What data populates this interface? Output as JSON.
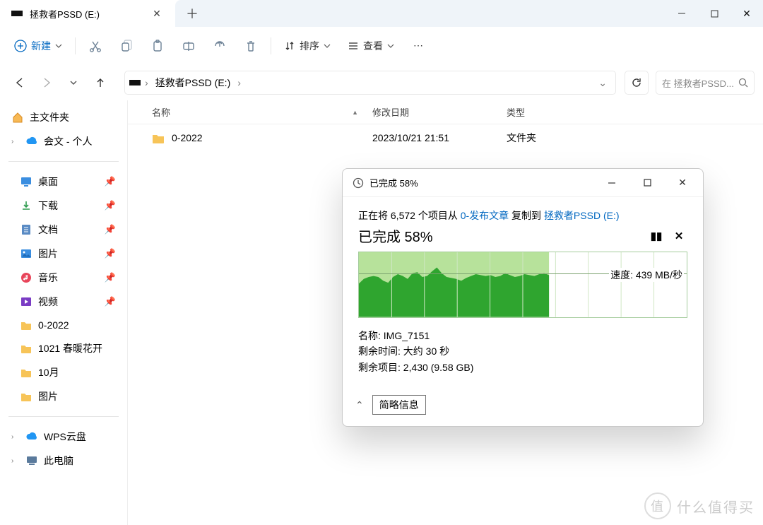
{
  "window": {
    "tab_title": "拯救者PSSD (E:)",
    "new_label": "新建",
    "sort_label": "排序",
    "view_label": "查看"
  },
  "breadcrumb": {
    "root": "拯救者PSSD (E:)",
    "search_placeholder": "在 拯救者PSSD..."
  },
  "sidebar": {
    "home": "主文件夹",
    "cloud": "会文 - 个人",
    "quick": [
      {
        "label": "桌面"
      },
      {
        "label": "下载"
      },
      {
        "label": "文档"
      },
      {
        "label": "图片"
      },
      {
        "label": "音乐"
      },
      {
        "label": "视频"
      }
    ],
    "folders": [
      {
        "label": "0-2022"
      },
      {
        "label": "1021 春暖花开"
      },
      {
        "label": "10月"
      },
      {
        "label": "图片"
      }
    ],
    "bottom": [
      {
        "label": "WPS云盘"
      },
      {
        "label": "此电脑"
      }
    ]
  },
  "columns": {
    "name": "名称",
    "date": "修改日期",
    "type": "类型"
  },
  "files": [
    {
      "name": "0-2022",
      "date": "2023/10/21 21:51",
      "type": "文件夹"
    }
  ],
  "dialog": {
    "title": "已完成 58%",
    "line_prefix": "正在将 6,572 个项目从 ",
    "src": "0-发布文章",
    "line_mid": " 复制到 ",
    "dst": "拯救者PSSD (E:)",
    "percent": "已完成 58%",
    "speed_prefix": "速度: ",
    "speed_value": "439 MB/秒",
    "name_label": "名称: ",
    "name_value": "IMG_7151",
    "remain_time_label": "剩余时间: ",
    "remain_time_value": "大约 30 秒",
    "remain_items_label": "剩余项目: ",
    "remain_items_value": "2,430 (9.58 GB)",
    "footer_btn": "简略信息"
  },
  "watermark": "什么值得买",
  "chart_data": {
    "type": "area",
    "title": "Transfer speed over time",
    "xlabel": "",
    "ylabel": "MB/秒",
    "ylim": [
      0,
      680
    ],
    "progress_fraction": 0.58,
    "series": [
      {
        "name": "speed",
        "values": [
          350,
          400,
          420,
          430,
          420,
          380,
          360,
          420,
          450,
          430,
          400,
          460,
          470,
          420,
          430,
          480,
          520,
          460,
          420,
          410,
          400,
          380,
          410,
          430,
          450,
          440,
          430,
          440,
          420,
          430,
          460,
          440,
          420,
          430,
          450,
          440,
          430,
          450,
          460,
          440
        ]
      }
    ],
    "current_speed": 439
  }
}
